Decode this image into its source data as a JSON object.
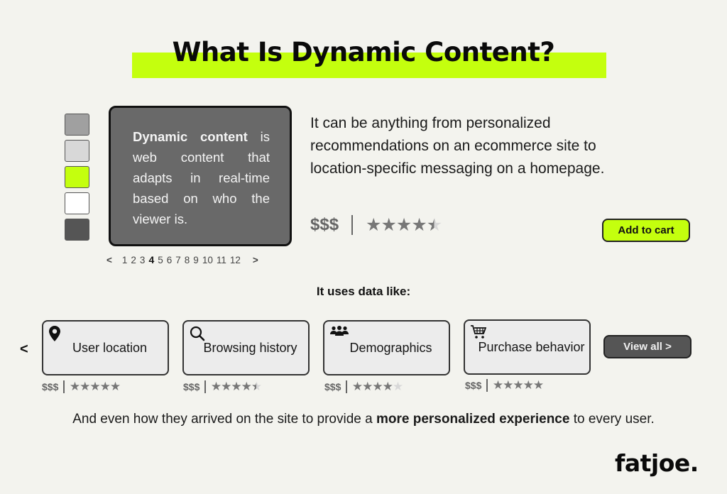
{
  "header": {
    "title": "What Is Dynamic Content?"
  },
  "swatches": [
    {
      "name": "swatch-gray",
      "color": "#a0a0a0"
    },
    {
      "name": "swatch-light-gray",
      "color": "#d8d8d8"
    },
    {
      "name": "swatch-lime",
      "color": "#c4ff0e"
    },
    {
      "name": "swatch-white",
      "color": "#ffffff"
    },
    {
      "name": "swatch-dark-gray",
      "color": "#555555"
    }
  ],
  "main_card": {
    "bold_text": "Dynamic content",
    "body_text": " is web content that adapts in real-time based on who the viewer is."
  },
  "pager": {
    "prev": "<",
    "next": ">",
    "pages": [
      "1",
      "2",
      "3",
      "4",
      "5",
      "6",
      "7",
      "8",
      "9",
      "10",
      "11",
      "12"
    ],
    "active_page": "4"
  },
  "description": "It can be anything from personalized recommendations on an ecommerce site to location-specific messaging on a homepage.",
  "main_price": {
    "price": "$$$",
    "rating": 4.5,
    "max_rating": 5
  },
  "add_to_cart": "Add to cart",
  "section_label": "It uses data like:",
  "carousel": {
    "prev": "<",
    "items": [
      {
        "label": "User location",
        "icon": "map-pin-icon",
        "price": "$$$",
        "rating": 5
      },
      {
        "label": "Browsing history",
        "icon": "search-icon",
        "price": "$$$",
        "rating": 4.5
      },
      {
        "label": "Demographics",
        "icon": "users-icon",
        "price": "$$$",
        "rating": 4
      },
      {
        "label": "Purchase behavior",
        "icon": "cart-icon",
        "price": "$$$",
        "rating": 5
      }
    ],
    "view_all": "View all  >"
  },
  "footer": {
    "text_before": "And even how they arrived on the site to provide a ",
    "text_bold": "more personalized experience",
    "text_after": " to every user."
  },
  "logo": "fatjoe.",
  "colors": {
    "accent": "#c4ff0e",
    "background": "#f3f3ee",
    "card_dark": "#696969"
  }
}
